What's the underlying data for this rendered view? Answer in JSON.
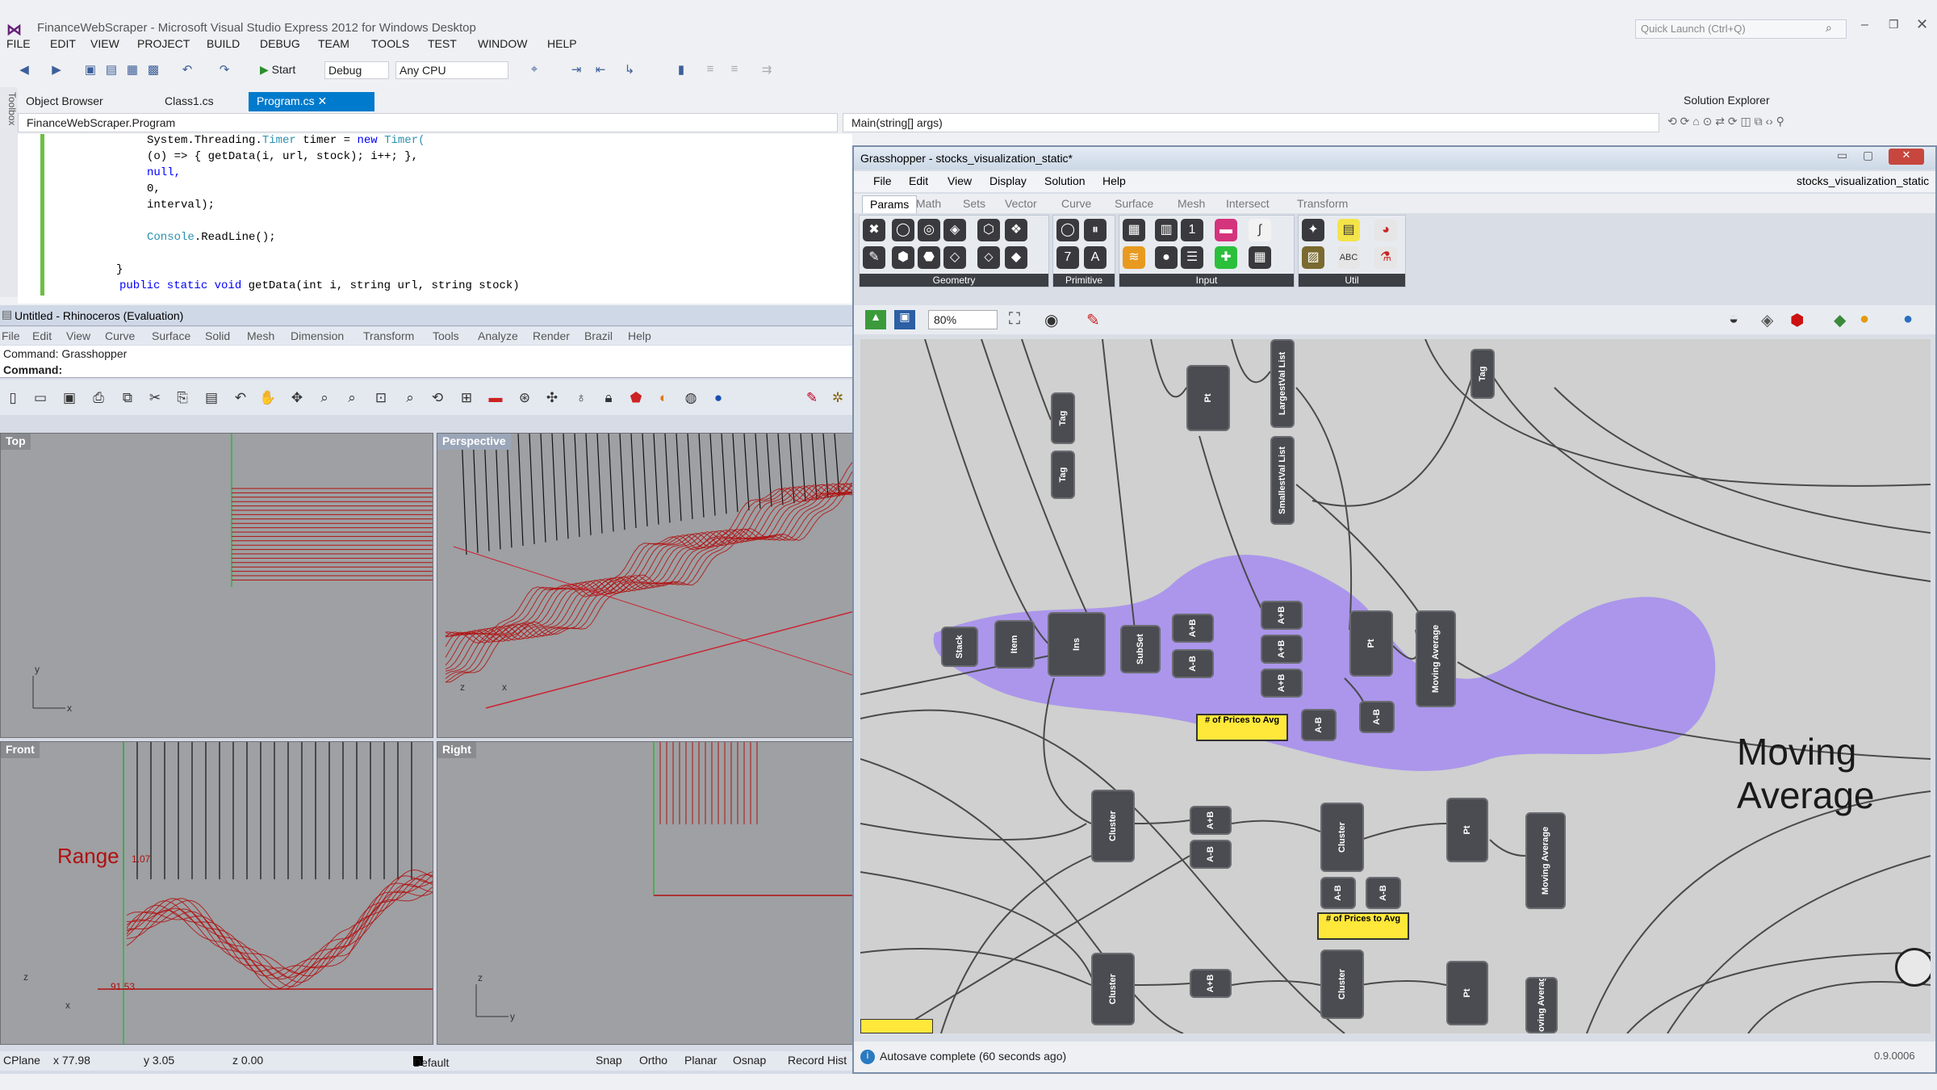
{
  "vs": {
    "title": "FinanceWebScraper - Microsoft Visual Studio Express 2012 for Windows Desktop",
    "quick_launch_placeholder": "Quick Launch (Ctrl+Q)",
    "menu": [
      "FILE",
      "EDIT",
      "VIEW",
      "PROJECT",
      "BUILD",
      "DEBUG",
      "TEAM",
      "TOOLS",
      "TEST",
      "WINDOW",
      "HELP"
    ],
    "toolbar": {
      "start_label": "Start",
      "config": "Debug",
      "platform": "Any CPU"
    },
    "toolbox_label": "Toolbox",
    "tabs": [
      "Object Browser",
      "Class1.cs",
      "Program.cs"
    ],
    "nav_left": "FinanceWebScraper.Program",
    "nav_right": "Main(string[] args)",
    "solution_explorer": "Solution Explorer",
    "code": [
      {
        "pre": "System.Threading.",
        "ty": "Timer",
        "mid": " timer = ",
        "kw": "new",
        "post": " Timer("
      },
      {
        "pre": "(o) => { getData(i, url, stock); i++; },",
        "ty": "",
        "mid": "",
        "kw": "",
        "post": ""
      },
      {
        "pre": "null,",
        "ty": "",
        "mid": "",
        "kw": "",
        "post": ""
      },
      {
        "pre": "0,",
        "ty": "",
        "mid": "",
        "kw": "",
        "post": ""
      },
      {
        "pre": "interval);",
        "ty": "",
        "mid": "",
        "kw": "",
        "post": ""
      },
      {
        "pre": "",
        "ty": "",
        "mid": "",
        "kw": "",
        "post": ""
      },
      {
        "pre": "",
        "ty": "Console",
        "mid": ".ReadLine();",
        "kw": "",
        "post": ""
      },
      {
        "pre": "",
        "ty": "",
        "mid": "",
        "kw": "",
        "post": ""
      },
      {
        "pre": "}",
        "ty": "",
        "mid": "",
        "kw": "",
        "post": ""
      },
      {
        "pre": "",
        "ty": "",
        "mid": "",
        "kw": "public static void",
        "post": " getData(int i, string url, string stock)"
      }
    ]
  },
  "rhino": {
    "title": "Untitled - Rhinoceros (Evaluation)",
    "menu": [
      "File",
      "Edit",
      "View",
      "Curve",
      "Surface",
      "Solid",
      "Mesh",
      "Dimension",
      "Transform",
      "Tools",
      "Analyze",
      "Render",
      "Brazil",
      "Help"
    ],
    "command_history": "Command: Grasshopper",
    "command_prompt": "Command:",
    "viewports": {
      "top": "Top",
      "perspective": "Perspective",
      "front": "Front",
      "right": "Right"
    },
    "front_annotation": {
      "label": "Range",
      "max": "1.07",
      "min": "91.53"
    },
    "status": {
      "cplane": "CPlane",
      "x": "x 77.98",
      "y": "y 3.05",
      "z": "z 0.00",
      "layer": "Default",
      "snap": "Snap",
      "ortho": "Ortho",
      "planar": "Planar",
      "osnap": "Osnap",
      "record": "Record Hist"
    }
  },
  "grasshopper": {
    "title": "Grasshopper - stocks_visualization_static*",
    "doc_name": "stocks_visualization_static",
    "menu": [
      "File",
      "Edit",
      "View",
      "Display",
      "Solution",
      "Help"
    ],
    "tabs": [
      "Params",
      "Math",
      "Sets",
      "Vector",
      "Curve",
      "Surface",
      "Mesh",
      "Intersect",
      "Transform"
    ],
    "ribbon_groups": [
      "Geometry",
      "Primitive",
      "Input",
      "Util"
    ],
    "zoom": "80%",
    "canvas_title": "Moving Average",
    "nodes": {
      "tag1": "Tag",
      "tag2": "Tag",
      "pt1": "Pt",
      "largest": "LargestVal List",
      "smallest": "SmallestVal List",
      "stack": "Stack",
      "item": "Item",
      "ins": "Ins",
      "subset": "SubSet",
      "ab": "A+B",
      "abm": "A-B",
      "pt2": "Pt",
      "moving": "Moving Average",
      "cluster": "Cluster",
      "prices": "# of Prices to Avg"
    },
    "status_text": "Autosave complete (60 seconds ago)",
    "version": "0.9.0006"
  },
  "colors": {
    "vs_accent": "#007acc",
    "gh_blob": "#a58cf0",
    "curve_red": "#b01010",
    "node_dark": "#4a4c51",
    "yellow": "#ffe83a"
  }
}
